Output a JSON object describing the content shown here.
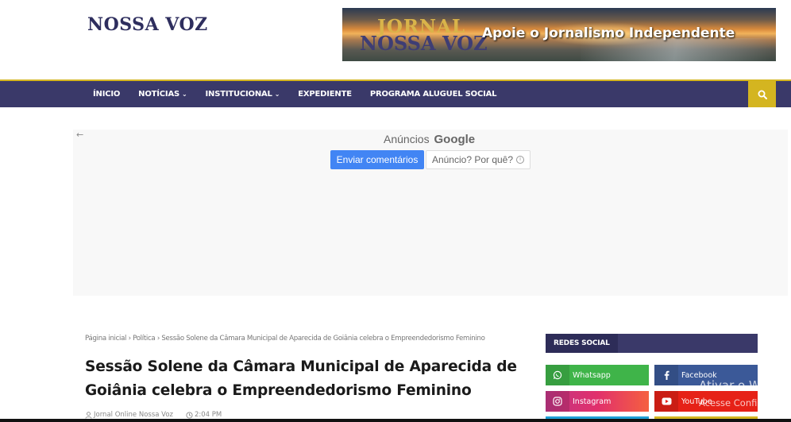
{
  "header": {
    "site_title": "NOSSA VOZ",
    "banner": {
      "logo_line1": "JORNAL",
      "logo_line2": "NOSSA VOZ",
      "slogan": "Apoie o Jornalismo Independente"
    }
  },
  "nav": {
    "items": [
      {
        "label": "ÍNICIO",
        "dropdown": false
      },
      {
        "label": "NOTÍCIAS",
        "dropdown": true
      },
      {
        "label": "INSTITUCIONAL",
        "dropdown": true
      },
      {
        "label": "EXPEDIENTE",
        "dropdown": false
      },
      {
        "label": "PROGRAMA ALUGUEL SOCIAL",
        "dropdown": false
      }
    ],
    "chevron": "⌄",
    "search_icon": "search-icon"
  },
  "ad": {
    "back_arrow": "←",
    "label": "Anúncios",
    "brand": "Google",
    "send_feedback": "Enviar comentários",
    "why_ad": "Anúncio? Por quê?",
    "info_glyph": "i"
  },
  "article": {
    "breadcrumb": "Página inicial › Política › Sessão Solene da Câmara Municipal de Aparecida de Goiânia celebra o Empreendedorismo Feminino",
    "title": "Sessão Solene da Câmara Municipal de Aparecida de Goiânia celebra o Empreendedorismo Feminino",
    "author": "Jornal Online Nossa Voz",
    "time": "2:04 PM"
  },
  "sidebar": {
    "heading": "REDES SOCIAL",
    "social": [
      {
        "name": "Whatsapp",
        "icon": "whatsapp-icon",
        "color": "#3fb449"
      },
      {
        "name": "Facebook",
        "icon": "facebook-icon",
        "color": "#3b5998"
      },
      {
        "name": "Instagram",
        "icon": "instagram-icon",
        "color": "#e1306c"
      },
      {
        "name": "YouTube",
        "icon": "youtube-icon",
        "color": "#e62117"
      }
    ]
  },
  "watermark": {
    "line1": "Ativar o Windows",
    "line2": "Acesse Configurações"
  },
  "colors": {
    "nav_bg": "#3a3969",
    "accent": "#d4b520"
  }
}
